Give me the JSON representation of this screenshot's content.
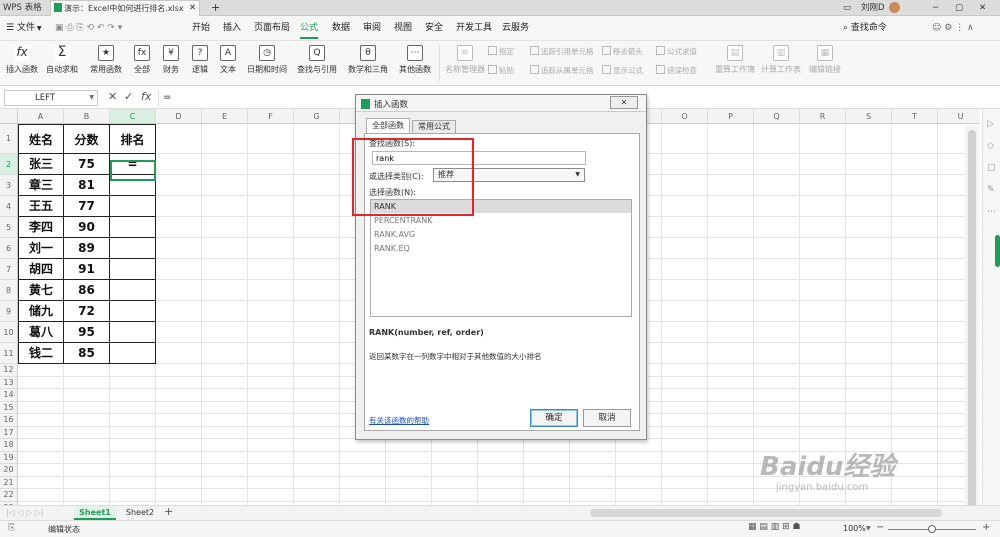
{
  "titlebar": {
    "app_tab": "WPS 表格",
    "doc_tab": "演示：Excel中如何进行排名.xlsx",
    "add_tab": "+",
    "user": "刘刚D"
  },
  "menu": {
    "file": "文件",
    "items": [
      "开始",
      "插入",
      "页面布局",
      "公式",
      "数据",
      "审阅",
      "视图",
      "安全",
      "开发工具",
      "云服务"
    ],
    "active_index": 3,
    "search": "查找命令"
  },
  "ribbon": {
    "buttons": [
      {
        "icon": "fx",
        "label": "插入函数"
      },
      {
        "icon": "Σ",
        "label": "自动求和"
      },
      {
        "icon": "★",
        "label": "常用函数"
      },
      {
        "icon": "fx",
        "label": "全部"
      },
      {
        "icon": "¥",
        "label": "财务"
      },
      {
        "icon": "?",
        "label": "逻辑"
      },
      {
        "icon": "A",
        "label": "文本"
      },
      {
        "icon": "◷",
        "label": "日期和时间"
      },
      {
        "icon": "Q",
        "label": "查找与引用"
      },
      {
        "icon": "θ",
        "label": "数学和三角"
      },
      {
        "icon": "⋯",
        "label": "其他函数"
      },
      {
        "icon": "≡",
        "label": "名称管理器"
      },
      {
        "icon": "▤",
        "label": "重算工作簿"
      },
      {
        "icon": "▥",
        "label": "计算工作表"
      },
      {
        "icon": "▦",
        "label": "编辑链接"
      }
    ],
    "small": [
      "指定",
      "粘贴",
      "追踪引用单元格",
      "追踪从属单元格",
      "移去箭头",
      "显示公式",
      "公式求值",
      "错误检查"
    ]
  },
  "formulabar": {
    "name_box": "LEFT",
    "formula": "="
  },
  "columns": [
    "A",
    "B",
    "C",
    "D",
    "E",
    "F",
    "G",
    "H",
    "I",
    "J",
    "K",
    "L",
    "M",
    "N",
    "O",
    "P",
    "Q",
    "R",
    "S",
    "T",
    "U"
  ],
  "table": {
    "headers": [
      "姓名",
      "分数",
      "排名"
    ],
    "rows": [
      [
        "张三",
        "75",
        "="
      ],
      [
        "章三",
        "81",
        ""
      ],
      [
        "王五",
        "77",
        ""
      ],
      [
        "李四",
        "90",
        ""
      ],
      [
        "刘一",
        "89",
        ""
      ],
      [
        "胡四",
        "91",
        ""
      ],
      [
        "黄七",
        "86",
        ""
      ],
      [
        "储九",
        "72",
        ""
      ],
      [
        "葛八",
        "95",
        ""
      ],
      [
        "钱二",
        "85",
        ""
      ]
    ]
  },
  "row_numbers": [
    "1",
    "2",
    "3",
    "4",
    "5",
    "6",
    "7",
    "8",
    "9",
    "10",
    "11",
    "12",
    "13",
    "14",
    "15",
    "16",
    "17",
    "18",
    "19",
    "20",
    "21",
    "22",
    "23",
    "24",
    "25"
  ],
  "dialog": {
    "title": "插入函数",
    "close": "✕",
    "tabs": [
      "全部函数",
      "常用公式"
    ],
    "search_label": "查找函数(S):",
    "search_value": "rank",
    "category_label": "或选择类别(C):",
    "category_value": "推荐",
    "list_label": "选择函数(N):",
    "functions": [
      "RANK",
      "PERCENTRANK",
      "RANK.AVG",
      "RANK.EQ"
    ],
    "signature": "RANK(number, ref, order)",
    "description": "返回某数字在一列数字中相对于其他数值的大小排名",
    "help_link": "有关该函数的帮助",
    "ok": "确定",
    "cancel": "取消"
  },
  "sheets": {
    "tabs": [
      "Sheet1",
      "Sheet2"
    ],
    "active": 0,
    "add": "+"
  },
  "status": {
    "mode": "编辑状态",
    "zoom": "100%"
  },
  "watermark": {
    "brand": "Baidu经验",
    "url": "jingyan.baidu.com"
  },
  "colors": {
    "accent": "#1e9e54",
    "highlight_red": "#e3262c",
    "link": "#1a4fc9"
  }
}
